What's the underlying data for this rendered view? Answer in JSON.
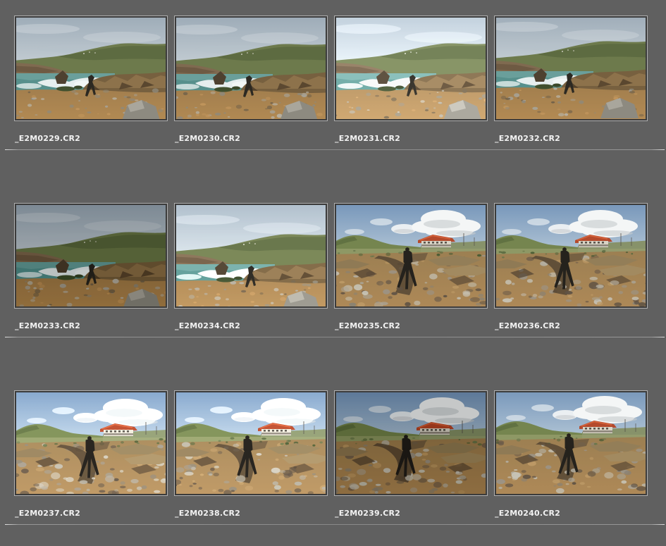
{
  "window": {
    "background_color": "#606060",
    "divider_color": "#8a8a8a",
    "label_color": "#f2f2f2",
    "thumb_border_color": "#b0b0b0",
    "thumb_matte_color": "#3b3b3b"
  },
  "grid": {
    "columns": 4,
    "rows": 3
  },
  "photos": [
    {
      "filename": "_E2M0229.CR2",
      "scene": "coast-waves",
      "exposure": "normal",
      "shift": [
        0,
        0
      ]
    },
    {
      "filename": "_E2M0230.CR2",
      "scene": "coast-waves",
      "exposure": "normal",
      "shift": [
        -3,
        1
      ]
    },
    {
      "filename": "_E2M0231.CR2",
      "scene": "coast-waves",
      "exposure": "overexposed",
      "shift": [
        2,
        0
      ]
    },
    {
      "filename": "_E2M0232.CR2",
      "scene": "coast-waves",
      "exposure": "normal",
      "shift": [
        -2,
        -3
      ]
    },
    {
      "filename": "_E2M0233.CR2",
      "scene": "coast-waves",
      "exposure": "dark",
      "shift": [
        1,
        2
      ]
    },
    {
      "filename": "_E2M0234.CR2",
      "scene": "coast-waves",
      "exposure": "bright",
      "shift": [
        0,
        5
      ]
    },
    {
      "filename": "_E2M0235.CR2",
      "scene": "cliff-house",
      "exposure": "normal",
      "shift": [
        0,
        0
      ]
    },
    {
      "filename": "_E2M0236.CR2",
      "scene": "cliff-house",
      "exposure": "normal",
      "shift": [
        -4,
        0
      ]
    },
    {
      "filename": "_E2M0237.CR2",
      "scene": "cliff-house",
      "exposure": "bright",
      "shift": [
        3,
        2
      ]
    },
    {
      "filename": "_E2M0238.CR2",
      "scene": "cliff-house",
      "exposure": "bright",
      "shift": [
        0,
        1
      ]
    },
    {
      "filename": "_E2M0239.CR2",
      "scene": "cliff-house",
      "exposure": "dark",
      "shift": [
        -2,
        0
      ]
    },
    {
      "filename": "_E2M0240.CR2",
      "scene": "cliff-house",
      "exposure": "normal",
      "shift": [
        2,
        -2
      ]
    }
  ]
}
